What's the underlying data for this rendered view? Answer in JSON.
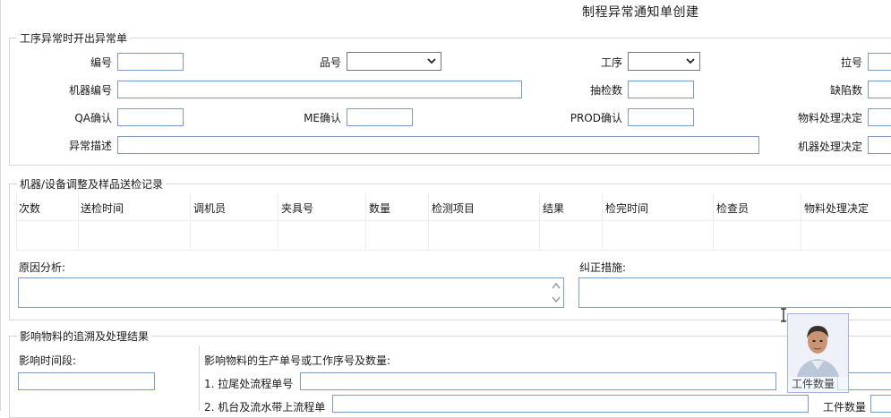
{
  "page": {
    "title": "制程异常通知单创建"
  },
  "section1": {
    "legend": "工序异常时开出异常单",
    "labels": {
      "number": "编号",
      "product_no": "品号",
      "process": "工序",
      "line_no": "拉号",
      "machine_no": "机器编号",
      "sample_qty": "抽检数",
      "defect_qty": "缺陷数",
      "qa_confirm": "QA确认",
      "me_confirm": "ME确认",
      "prod_confirm": "PROD确认",
      "material_decision": "物料处理决定",
      "anomaly_desc": "异常描述",
      "machine_decision": "机器处理决定"
    }
  },
  "section2": {
    "legend": "机器/设备调整及样品送检记录",
    "columns": [
      "次数",
      "送检时间",
      "调机员",
      "夹具号",
      "数量",
      "检测项目",
      "结果",
      "检完时间",
      "检查员",
      "物料处理决定"
    ],
    "cause_label": "原因分析:",
    "correction_label": "纠正措施:"
  },
  "section3": {
    "legend": "影响物料的追溯及处理结果",
    "time_period_label": "影响时间段:",
    "order_label": "影响物料的生产单号或工作序号及数量:",
    "row1_label": "1. 拉尾处流程单号",
    "row2_label": "2. 机台及流水带上流程单",
    "piece_qty_label": "工件数量"
  },
  "overlay": {
    "caption": "工件数量"
  }
}
